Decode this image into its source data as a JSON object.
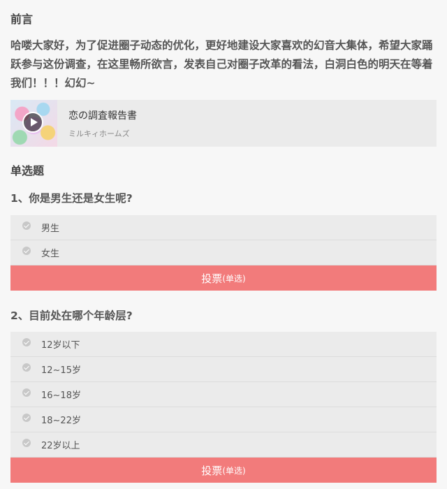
{
  "preface": {
    "title": "前言",
    "text": "哈喽大家好，为了促进圈子动态的优化，更好地建设大家喜欢的幻音大集体，希望大家踊跃参与这份调查，在这里畅所欲言，发表自己对圈子改革的看法，白洞白色的明天在等着我们！！！幻幻~"
  },
  "music": {
    "title": "恋の調査報告書",
    "artist": "ミルキィホームズ",
    "icon": "play-icon"
  },
  "section": {
    "title": "单选题"
  },
  "questions": [
    {
      "text": "1、你是男生还是女生呢?",
      "options": [
        "男生",
        "女生"
      ],
      "vote_label": "投票",
      "vote_sub": "(单选)"
    },
    {
      "text": "2、目前处在哪个年龄层?",
      "options": [
        "12岁以下",
        "12~15岁",
        "16~18岁",
        "18~22岁",
        "22岁以上"
      ],
      "vote_label": "投票",
      "vote_sub": "(单选)"
    }
  ],
  "colors": {
    "accent": "#f27b7b",
    "option_bg": "#ebebeb",
    "page_bg": "#f7f7f7"
  }
}
